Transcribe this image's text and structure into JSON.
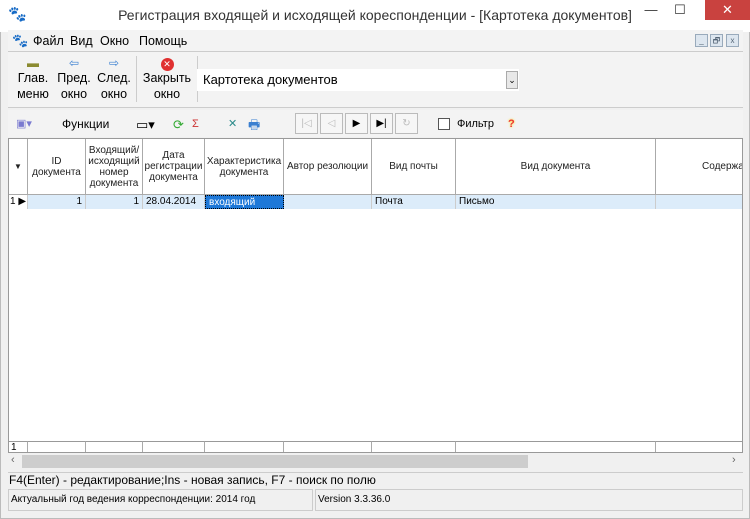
{
  "window": {
    "title": "Регистрация входящей и исходящей кореспонденции - [Картотека документов]",
    "minimize": "—",
    "maximize": "☐",
    "close": "✕"
  },
  "menu": {
    "items": [
      "Файл",
      "Вид",
      "Окно",
      "Помощь"
    ],
    "mdi": [
      "_",
      "🗗",
      "x"
    ]
  },
  "toolbar": {
    "main_menu": [
      "Глав.",
      "меню"
    ],
    "prev": [
      "Пред.",
      "окно"
    ],
    "next": [
      "След.",
      "окно"
    ],
    "close": [
      "Закрыть",
      "окно"
    ],
    "selector_value": "Картотека документов"
  },
  "toolbar2": {
    "functions": "Функции",
    "filter": "Фильтр",
    "help": "?",
    "nav": [
      "|◁",
      "◁",
      "▶",
      "▶|",
      "↻"
    ]
  },
  "grid": {
    "columns": [
      "ID документа",
      "Входящий/ исходящий номер документа",
      "Дата регистрации документа",
      "Характеристика документа",
      "Автор резолюции",
      "Вид почты",
      "Вид документа",
      "Содержа"
    ],
    "rows": [
      {
        "num": "1",
        "cells": [
          "1",
          "1",
          "28.04.2014",
          "входящий",
          "",
          "Почта",
          "Письмо",
          ""
        ]
      }
    ],
    "footer_count": "1"
  },
  "hint": "F4(Enter) - редактирование;Ins - новая запись, F7 - поиск по полю",
  "status": {
    "year": "Актуальный год ведения корреспонденции: 2014 год",
    "version": "Version 3.3.36.0"
  }
}
